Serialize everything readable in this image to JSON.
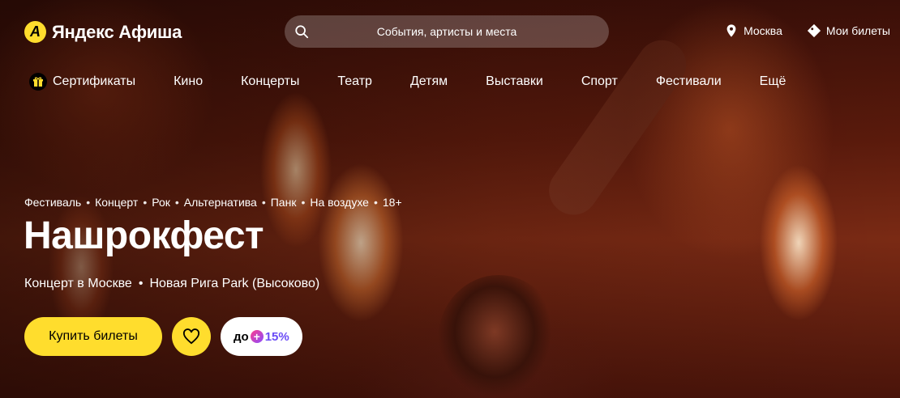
{
  "header": {
    "logo_mark": "A",
    "logo_text": "Яндекс Афиша",
    "search_placeholder": "События, артисты и места",
    "city": "Москва",
    "my_tickets": "Мои билеты"
  },
  "nav": {
    "items": [
      {
        "label": "Сертификаты",
        "icon": "gift-icon"
      },
      {
        "label": "Кино"
      },
      {
        "label": "Концерты"
      },
      {
        "label": "Театр"
      },
      {
        "label": "Детям"
      },
      {
        "label": "Выставки"
      },
      {
        "label": "Спорт"
      },
      {
        "label": "Фестивали"
      },
      {
        "label": "Ещё"
      }
    ]
  },
  "event": {
    "tags": [
      "Фестиваль",
      "Концерт",
      "Рок",
      "Альтернатива",
      "Панк",
      "На воздухе",
      "18+"
    ],
    "tag_separator": "•",
    "title": "Нашрокфест",
    "meta_type": "Концерт в Москве",
    "meta_separator": "•",
    "meta_place": "Новая Рига Park (Высоково)",
    "buy_label": "Купить билеты",
    "cashback_prefix": "до",
    "cashback_value": "15%"
  },
  "colors": {
    "accent": "#ffdd2d",
    "plus_gradient_start": "#ff3d8b",
    "plus_gradient_end": "#8a4cff"
  }
}
